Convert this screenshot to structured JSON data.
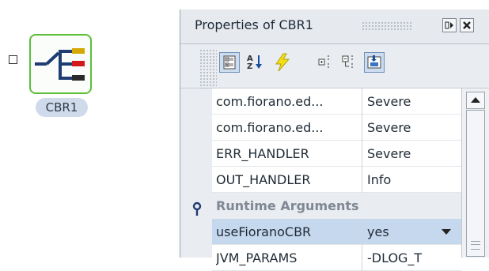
{
  "canvas": {
    "component_label": "CBR1",
    "component_border_color": "#5cbf3a"
  },
  "panel": {
    "title": "Properties of CBR1",
    "title_buttons": [
      "float-icon",
      "close-icon"
    ],
    "toolbar_icons": [
      "categorized-icon",
      "sort-alpha-icon",
      "events-icon",
      "expand-all-icon",
      "collapse-all-icon",
      "description-icon"
    ],
    "rows": [
      {
        "name": "com.fiorano.ed...",
        "value": "Severe"
      },
      {
        "name": "com.fiorano.ed...",
        "value": "Severe"
      },
      {
        "name": "ERR_HANDLER",
        "value": "Severe"
      },
      {
        "name": "OUT_HANDLER",
        "value": "Info"
      }
    ],
    "category": "Runtime Arguments",
    "selected_row": {
      "name": "useFioranoCBR",
      "value": "yes"
    },
    "partial_row": {
      "name": "JVM_PARAMS",
      "value": "-DLOG_T"
    },
    "selection_color": "#c6d8ee"
  }
}
